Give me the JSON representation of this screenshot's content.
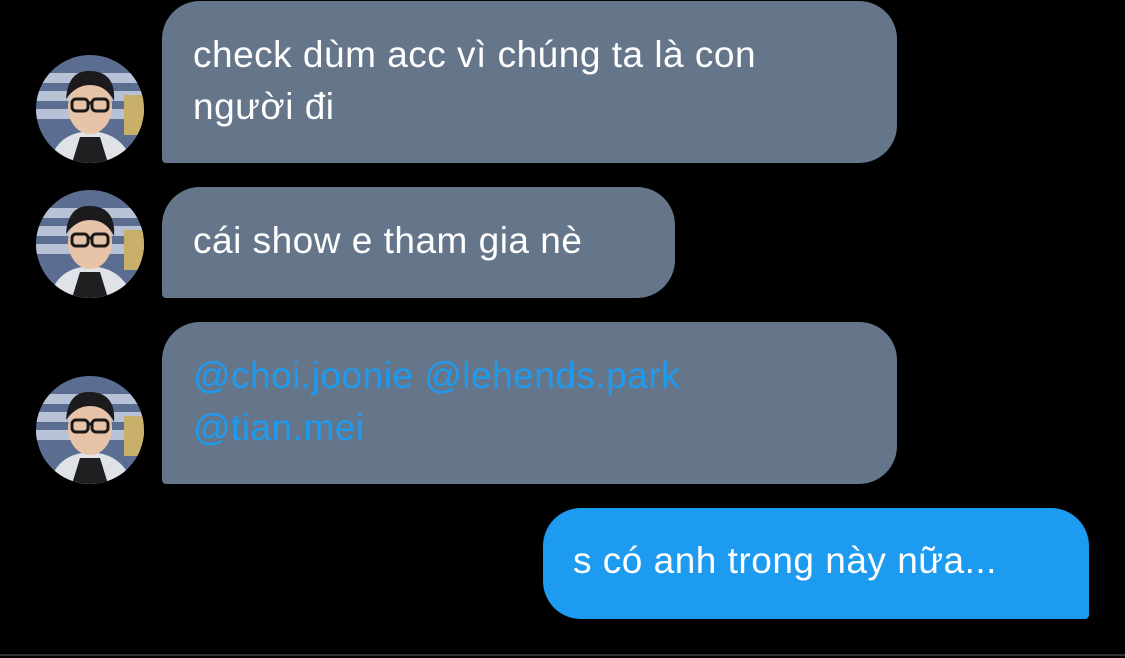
{
  "messages": [
    {
      "direction": "incoming",
      "text": "check dùm acc vì chúng ta là con người đi"
    },
    {
      "direction": "incoming",
      "text": "cái show e tham gia nè"
    },
    {
      "direction": "incoming",
      "mentions": [
        "@choi.joonie",
        "@lehends.park",
        "@tian.mei"
      ]
    },
    {
      "direction": "outgoing",
      "text": "s có anh trong này nữa..."
    }
  ],
  "colors": {
    "background": "#000000",
    "incoming_bubble": "#66768a",
    "outgoing_bubble": "#1d9bf0",
    "mention_link": "#1d9bf0"
  }
}
